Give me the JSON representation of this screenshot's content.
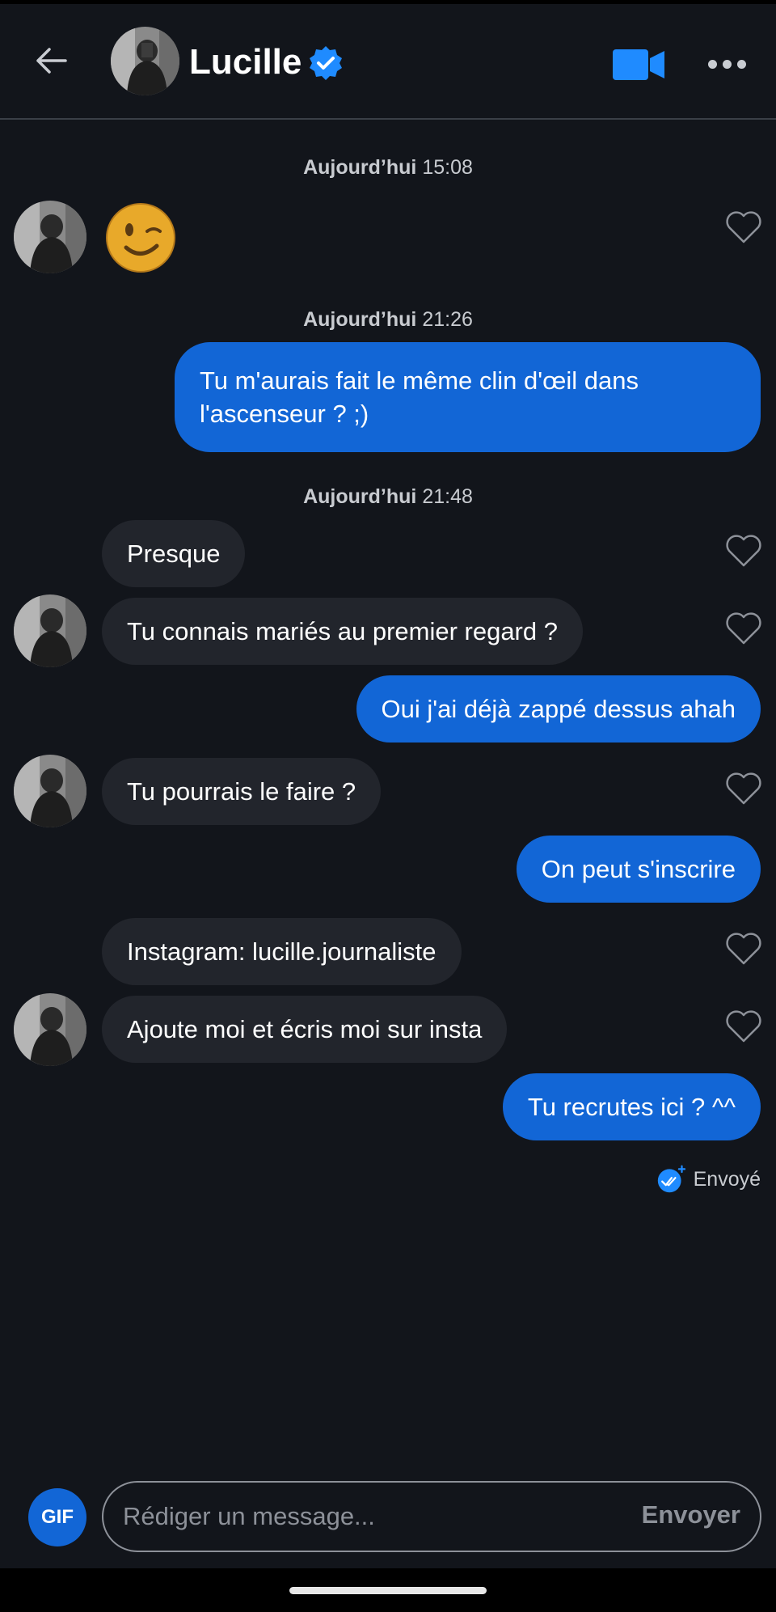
{
  "header": {
    "name": "Lucille",
    "verified": true
  },
  "messages": [
    {
      "type": "timestamp",
      "day": "Aujourd’hui",
      "time": "15:08"
    },
    {
      "type": "emoji",
      "from": "them",
      "emoji": "winking-face"
    },
    {
      "type": "timestamp",
      "day": "Aujourd’hui",
      "time": "21:26"
    },
    {
      "type": "text",
      "from": "me",
      "text": "Tu m'aurais fait le même clin d'œil dans l'ascenseur ? ;)"
    },
    {
      "type": "timestamp",
      "day": "Aujourd’hui",
      "time": "21:48"
    },
    {
      "type": "text",
      "from": "them",
      "text": "Presque"
    },
    {
      "type": "text",
      "from": "them",
      "text": "Tu connais mariés au premier regard ?"
    },
    {
      "type": "text",
      "from": "me",
      "text": "Oui j'ai déjà zappé dessus ahah"
    },
    {
      "type": "text",
      "from": "them",
      "text": "Tu pourrais le faire ?"
    },
    {
      "type": "text",
      "from": "me",
      "text": "On peut s'inscrire"
    },
    {
      "type": "text",
      "from": "them",
      "text": "Instagram: lucille.journaliste"
    },
    {
      "type": "text",
      "from": "them",
      "text": "Ajoute moi et écris moi sur insta"
    },
    {
      "type": "text",
      "from": "me",
      "text": "Tu recrutes ici ? ^^"
    }
  ],
  "status": {
    "sent": "Envoyé"
  },
  "composer": {
    "gif_label": "GIF",
    "placeholder": "Rédiger un message...",
    "send_label": "Envoyer"
  },
  "colors": {
    "background": "#12151b",
    "incoming_bubble": "#22252c",
    "outgoing_bubble": "#1266d6",
    "accent": "#1f8bff"
  }
}
